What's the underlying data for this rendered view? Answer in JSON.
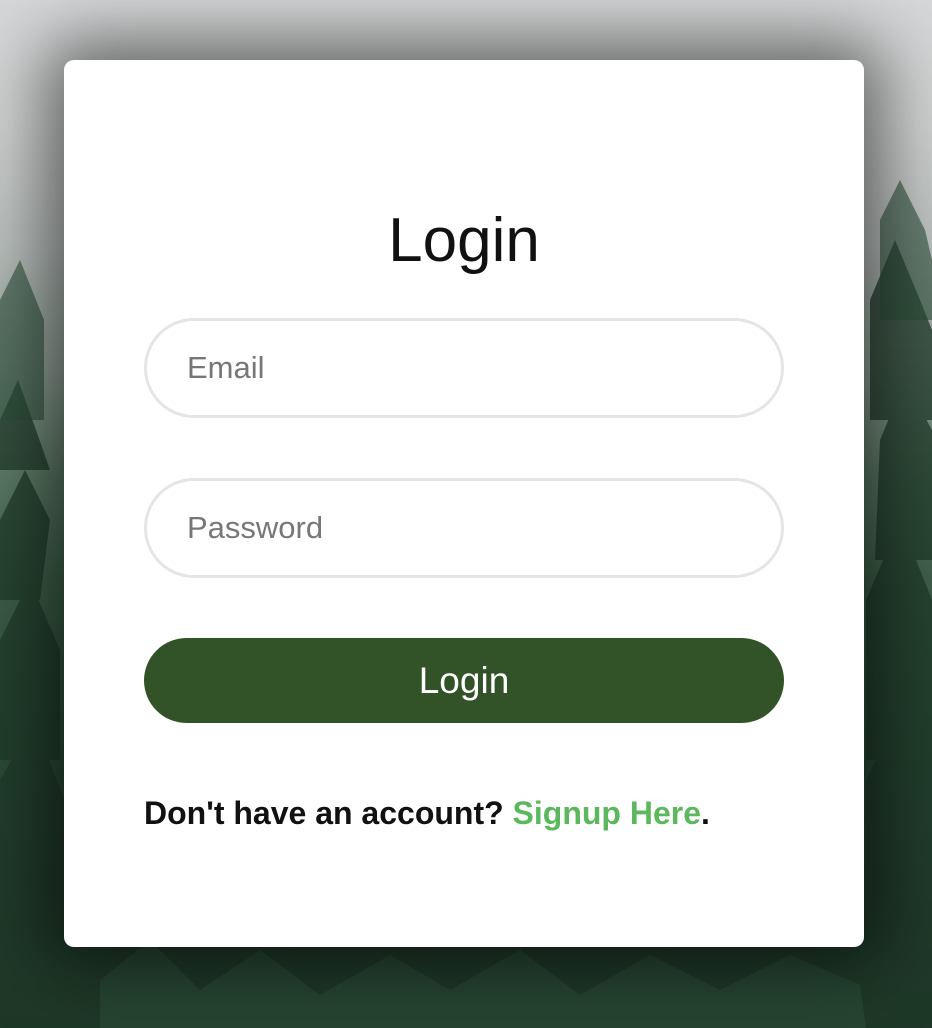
{
  "login_form": {
    "title": "Login",
    "email_placeholder": "Email",
    "password_placeholder": "Password",
    "submit_label": "Login",
    "signup_prompt": "Don't have an account? ",
    "signup_link_label": "Signup Here",
    "signup_suffix": "."
  },
  "colors": {
    "button_bg": "#325228",
    "link": "#5cb85c",
    "card_bg": "#ffffff"
  }
}
